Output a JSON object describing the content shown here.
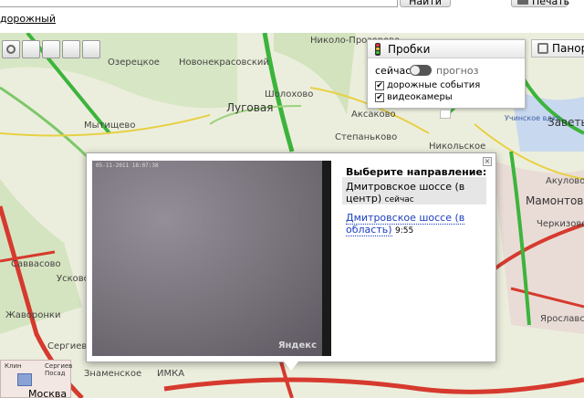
{
  "topbar": {
    "find_label": "Найти",
    "print_label": "Печать",
    "road_link": "дорожный"
  },
  "traffic": {
    "title": "Пробки",
    "now": "сейчас",
    "forecast": "прогноз",
    "events_label": "дорожные события",
    "events_checked": true,
    "cams_label": "видеокамеры",
    "cams_checked": true
  },
  "panorama": {
    "label": "Панорам"
  },
  "camera": {
    "stamp": "05-11-2011 18:07:38",
    "watermark": "Яндекс",
    "title": "Выберите направление:",
    "dir1_label": "Дмитровское шоссе (в центр)",
    "dir1_time": "сейчас",
    "dir2_label": "Дмитровское шоссе (в область)",
    "dir2_time": "9:55",
    "close": "×"
  },
  "map": {
    "labels": {
      "ozerechie": "Озерецкое",
      "novonekrasovsky": "Новонекрасовский",
      "nikolo_prozorovo": "Николо-Прозорово",
      "sholokhovo": "Шолохово",
      "lugovaya": "Луговая",
      "akisovo": "Аксаково",
      "mytishchevo": "Мытищево",
      "stepankovo": "Степаньково",
      "nikolskoe": "Никольское",
      "uchinsk": "Учинское вдхр.",
      "zavety": "Заветы",
      "akulovo": "Акулово",
      "mamontovka": "Мамонтовка Пр",
      "cherkizovo": "Черкизово",
      "savvasovo": "Саввасово",
      "uskovo": "Усково",
      "zhavoronki": "Жаворонки",
      "sergeevo": "Сергиево",
      "ramenskoe": "Ярославское",
      "moskva_mini": "Москва",
      "klin": "Клин",
      "sergiev": "Сергиев Посад",
      "znamenskoe": "Знаменское",
      "mirage": "ИМКА"
    },
    "colors": {
      "green": "#3cb43c",
      "red": "#d63a2e",
      "yellow": "#e7d044"
    }
  }
}
